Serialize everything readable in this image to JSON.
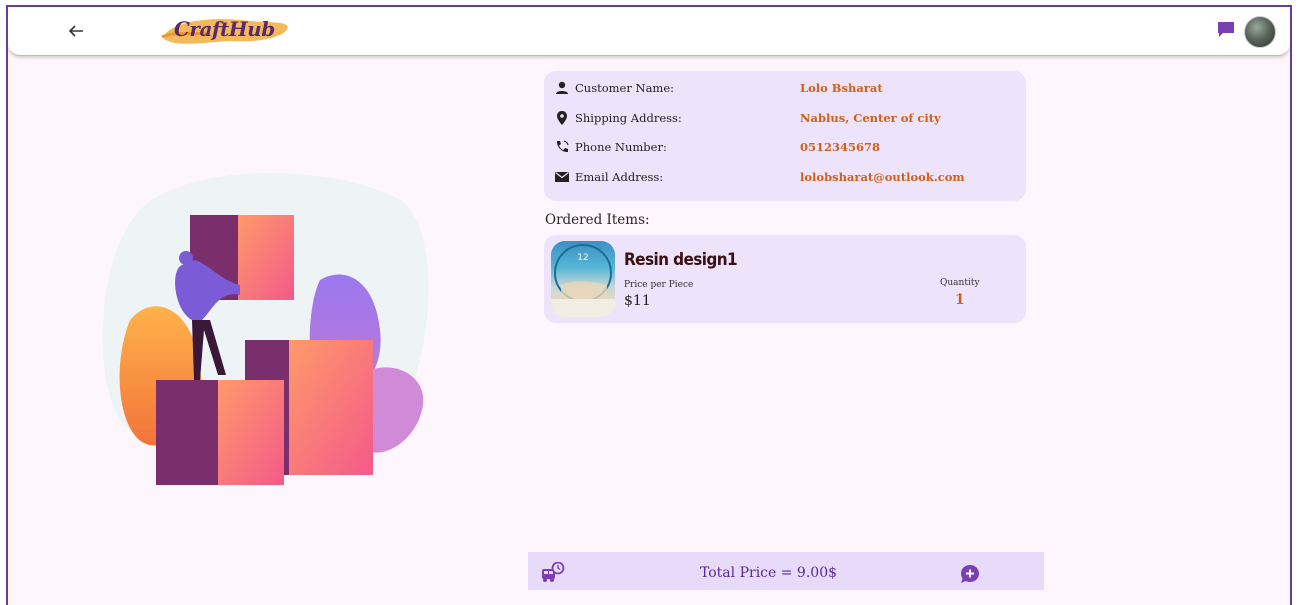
{
  "appbar": {
    "logo_text": "CraftHub",
    "back_icon": "arrow-left-icon",
    "chat_icon": "chat-icon"
  },
  "customer": {
    "rows": [
      {
        "icon": "person-icon",
        "label": "Customer Name:",
        "value": "Lolo Bsharat"
      },
      {
        "icon": "location-pin-icon",
        "label": "Shipping Address:",
        "value": "Nablus, Center of city"
      },
      {
        "icon": "phone-icon",
        "label": "Phone Number:",
        "value": "0512345678"
      },
      {
        "icon": "email-icon",
        "label": "Email Address:",
        "value": "lolobsharat@outlook.com"
      }
    ]
  },
  "ordered": {
    "title": "Ordered Items:",
    "items": [
      {
        "name": "Resin design1",
        "price_label": "Price per Piece",
        "price": "$11",
        "quantity_label": "Quantity",
        "quantity": "1"
      }
    ]
  },
  "footer": {
    "total": "Total Price = 9.00$",
    "left_icon": "delivery-truck-clock-icon",
    "right_icon": "add-chat-icon"
  },
  "colors": {
    "accent": "#6a3aa0",
    "value_orange": "#d1601a",
    "card_bg": "#ede3fb",
    "page_bg": "#fdf7fd"
  }
}
